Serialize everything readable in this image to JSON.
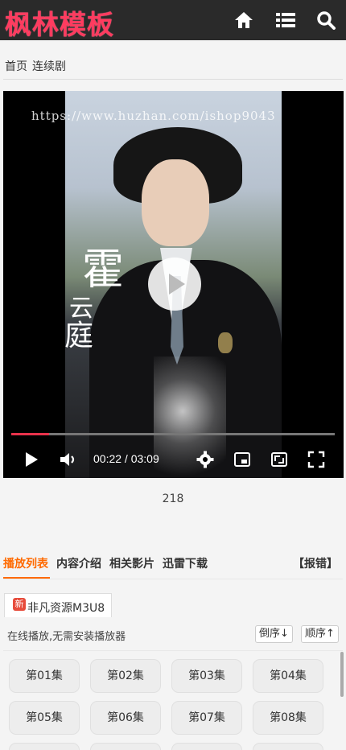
{
  "header": {
    "logo": "枫林模板",
    "icons": [
      "home-icon",
      "list-icon",
      "search-icon"
    ]
  },
  "breadcrumb": [
    "首页",
    "连续剧"
  ],
  "player": {
    "watermark": "https://www.huzhan.com/ishop9043",
    "poster_name": "霍",
    "poster_name2": "云",
    "poster_name3": "庭",
    "current_time": "00:22",
    "duration": "03:09",
    "time_display": "00:22 / 03:09",
    "progress_fraction": 0.116,
    "accent_color": "#e8324b"
  },
  "views": "218",
  "tabs": {
    "items": [
      "播放列表",
      "内容介绍",
      "相关影片",
      "迅雷下载"
    ],
    "active": 0,
    "report": "【报错】",
    "accent_color": "#ff6a00"
  },
  "source": {
    "badge": "新",
    "label": "非凡资源M3U8"
  },
  "playlist": {
    "hint": "在线播放,无需安装播放器",
    "sort_desc": "倒序↓",
    "sort_asc": "顺序↑",
    "episodes": [
      "第01集",
      "第02集",
      "第03集",
      "第04集",
      "第05集",
      "第06集",
      "第07集",
      "第08集"
    ]
  }
}
